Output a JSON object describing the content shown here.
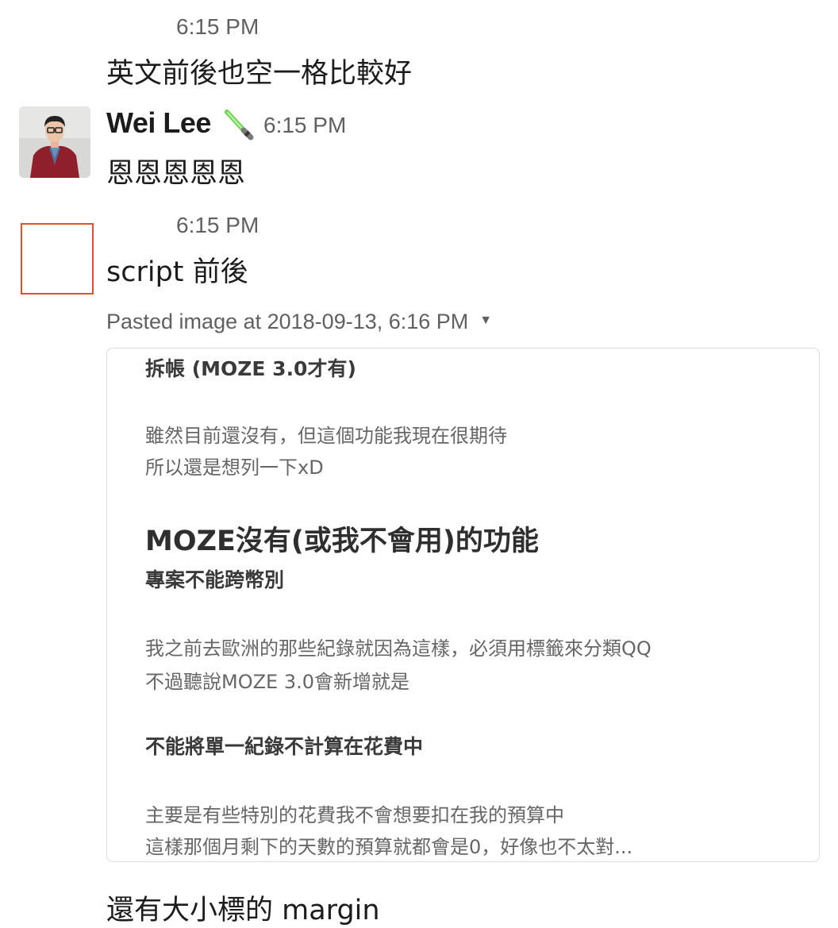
{
  "messages": [
    {
      "time": "6:15 PM",
      "text": "英文前後也空一格比較好"
    },
    {
      "username": "Wei Lee",
      "status_icon": "lightsaber-emoji",
      "time": "6:15 PM",
      "text": "恩恩恩恩恩"
    },
    {
      "time": "6:15 PM",
      "text": "script 前後",
      "attachment": {
        "title": "Pasted image at 2018-09-13, 6:16 PM",
        "caret_icon": "caret-down-icon",
        "content": {
          "heading1": "拆帳 (MOZE 3.0才有)",
          "para1_line1": "雖然目前還沒有，但這個功能我現在很期待",
          "para1_line2": " 所以還是想列一下xD",
          "main_heading": "MOZE沒有(或我不會用)的功能",
          "heading2": "專案不能跨幣別",
          "para2_line1": "我之前去歐洲的那些紀錄就因為這樣，必須用標籤來分類QQ",
          "para2_line2": "不過聽說MOZE 3.0會新增就是",
          "heading3": "不能將單一紀錄不計算在花費中",
          "para3_line1": "主要是有些特別的花費我不會想要扣在我的預算中",
          "para3_line2": " 這樣那個月剩下的天數的預算就都會是0，好像也不太對..."
        }
      }
    },
    {
      "text": "還有大小標的 margin"
    }
  ],
  "colors": {
    "text": "#1d1c1d",
    "muted": "#616061",
    "avatar_border": "#e0522f"
  }
}
